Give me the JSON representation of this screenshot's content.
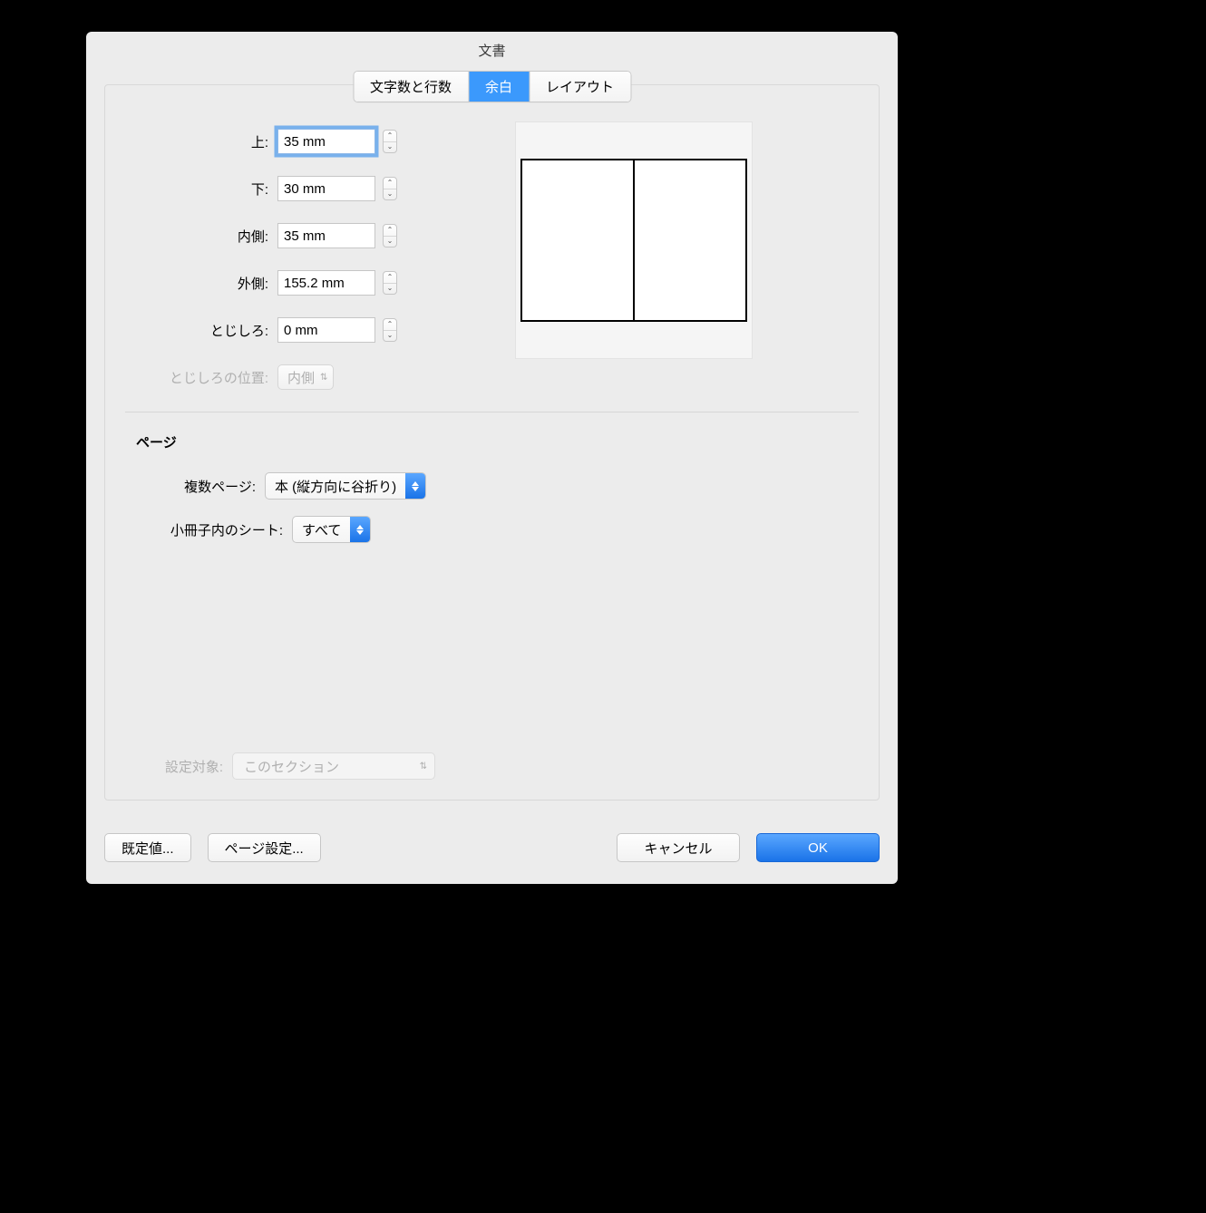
{
  "window": {
    "title": "文書"
  },
  "tabs": [
    {
      "label": "文字数と行数",
      "active": false
    },
    {
      "label": "余白",
      "active": true
    },
    {
      "label": "レイアウト",
      "active": false
    }
  ],
  "margins": {
    "top": {
      "label": "上:",
      "value": "35 mm"
    },
    "bottom": {
      "label": "下:",
      "value": "30 mm"
    },
    "inner": {
      "label": "内側:",
      "value": "35 mm"
    },
    "outer": {
      "label": "外側:",
      "value": "155.2 mm"
    },
    "gutter": {
      "label": "とじしろ:",
      "value": "0 mm"
    },
    "gutter_pos": {
      "label": "とじしろの位置:",
      "value": "内側"
    }
  },
  "pages": {
    "heading": "ページ",
    "multi": {
      "label": "複数ページ:",
      "value": "本 (縦方向に谷折り)"
    },
    "sheets": {
      "label": "小冊子内のシート:",
      "value": "すべて"
    }
  },
  "apply": {
    "label": "設定対象:",
    "value": "このセクション"
  },
  "buttons": {
    "default": "既定値...",
    "page_setup": "ページ設定...",
    "cancel": "キャンセル",
    "ok": "OK"
  }
}
